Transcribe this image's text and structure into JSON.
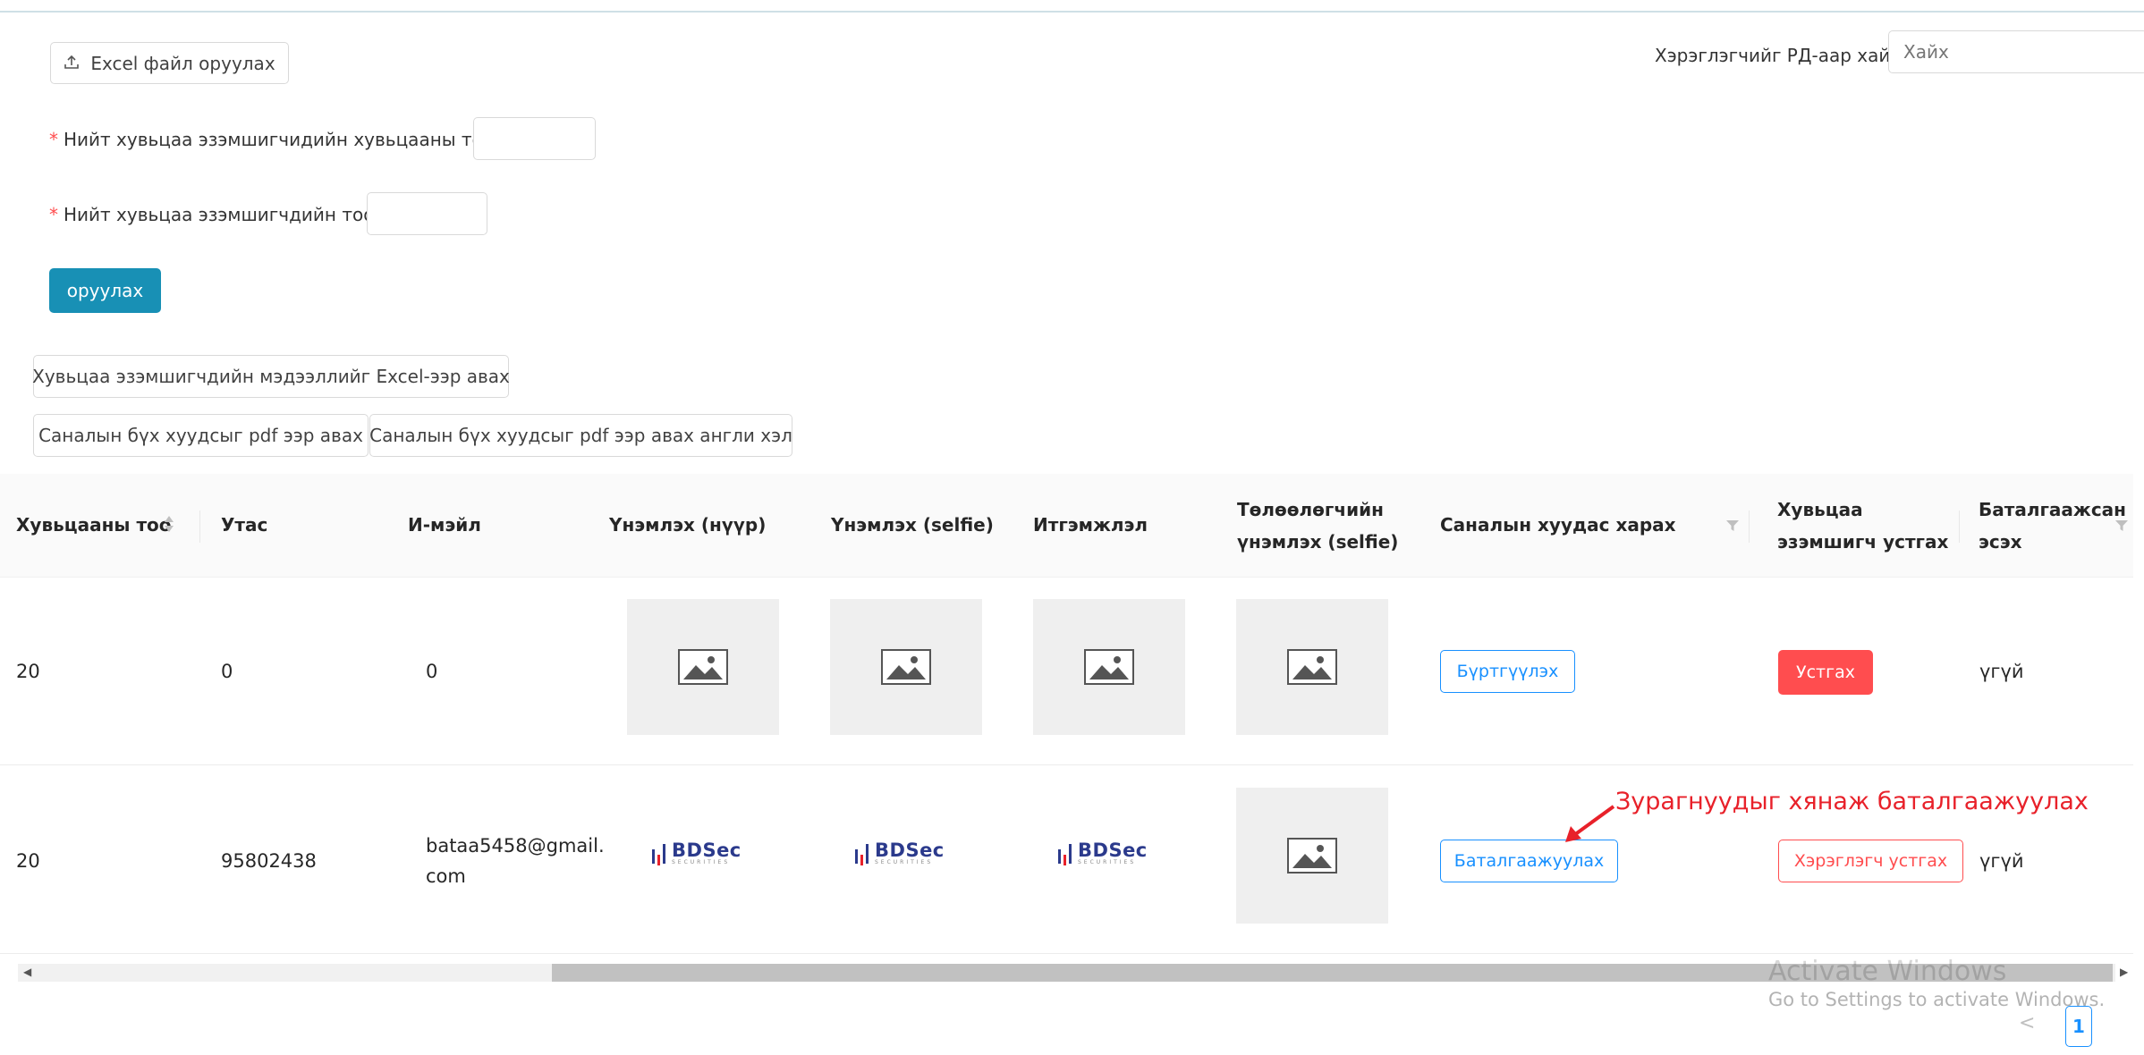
{
  "toolbar": {
    "excel_upload_label": "Excel файл оруулах",
    "search_label": "Хэрэглэгчийг РД-аар хайх",
    "search_placeholder": "Хайх"
  },
  "form": {
    "total_shares_label": "Нийт хувьцаа эзэмшигчидийн хувьцааны тоо:",
    "total_shareholders_label": "Нийт хувьцаа эзэмшигчдийн тоо:",
    "required_mark": "*",
    "submit_label": "оруулах"
  },
  "actions": {
    "export_excel_label": "Хувьцаа эзэмшигчдийн мэдээллийг Excel-ээр авах",
    "export_pdf_label": "Саналын бүх хуудсыг pdf ээр авах",
    "export_pdf_en_label": "Саналын бүх хуудсыг pdf ээр авах англи хэл"
  },
  "table": {
    "columns": [
      "Хувьцааны тоо",
      "Утас",
      "И-мэйл",
      "Үнэмлэх (нүүр)",
      "Үнэмлэх (selfie)",
      "Итгэмжлэл",
      "Төлөөлөгчийн үнэмлэх (selfie)",
      "Саналын хуудас харах",
      "Хувьцаа эзэмшигч устгах",
      "Баталгаажсан эсэх"
    ],
    "column_lines": {
      "representative_1": "Төлөөлөгчийн",
      "representative_2": "үнэмлэх (selfie)",
      "delete_1": "Хувьцаа",
      "delete_2": "эзэмшигч устгах",
      "verified_1": "Баталгаажсан",
      "verified_2": "эсэх"
    },
    "rows": [
      {
        "shares": "20",
        "phone": "0",
        "email": "0",
        "ballot_action": "Бүртгүүлэх",
        "delete_action": "Устгах",
        "verified": "үгүй"
      },
      {
        "shares": "20",
        "phone": "95802438",
        "email_1": "bataa5458@gmail.",
        "email_2": "com",
        "logo_text": "BDSec",
        "logo_sub": "SECURITIES",
        "ballot_action": "Баталгаажуулах",
        "delete_action": "Хэрэглэгч устгах",
        "verified": "үгүй"
      }
    ]
  },
  "annotation": "Зурагнуудыг хянаж баталгаажуулах",
  "watermark": {
    "line1": "Activate Windows",
    "line2": "Go to Settings to activate Windows."
  },
  "pagination": {
    "prev": "<",
    "current_page": "1"
  },
  "colors": {
    "primary": "#1890b5",
    "link_blue": "#1890ff",
    "danger": "#ff4d4f",
    "annotation_red": "#e8212a"
  }
}
